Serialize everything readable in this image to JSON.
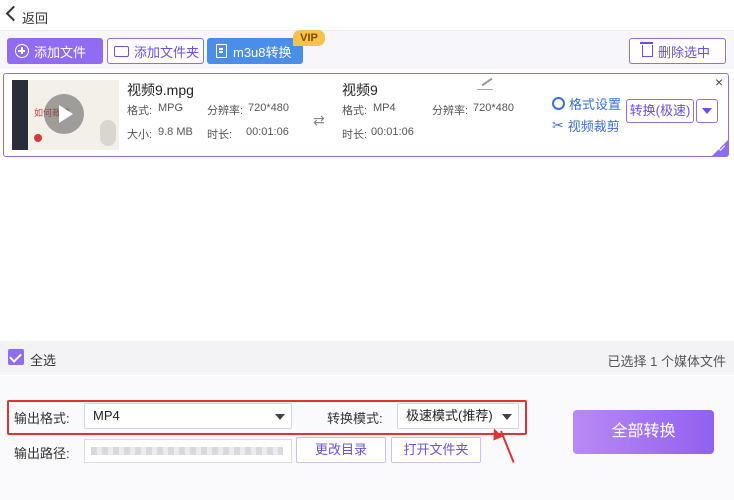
{
  "nav": {
    "back_label": "返回"
  },
  "toolbar": {
    "add_file": "添加文件",
    "add_folder": "添加文件夹",
    "m3u8": "m3u8转换",
    "vip": "VIP",
    "delete_selected": "删除选中"
  },
  "file_item": {
    "thumbnail_text": "如何裁剪",
    "source": {
      "name": "视频9.mpg",
      "format_label": "格式:",
      "format": "MPG",
      "resolution_label": "分辨率:",
      "resolution": "720*480",
      "size_label": "大小:",
      "size": "9.8 MB",
      "duration_label": "时长:",
      "duration": "00:01:06"
    },
    "target": {
      "name": "视频9",
      "format_label": "格式:",
      "format": "MP4",
      "resolution_label": "分辨率:",
      "resolution": "720*480",
      "duration_label": "时长:",
      "duration": "00:01:06"
    },
    "format_settings": "格式设置",
    "video_crop": "视频裁剪",
    "convert_button": "转换(极速)",
    "close": "×"
  },
  "selection": {
    "select_all": "全选",
    "count_text": "已选择 1 个媒体文件"
  },
  "output": {
    "format_label": "输出格式:",
    "format_value": "MP4",
    "mode_label": "转换模式:",
    "mode_value": "极速模式(推荐)",
    "path_label": "输出路径:",
    "change_dir": "更改目录",
    "open_folder": "打开文件夹",
    "convert_all": "全部转换"
  },
  "colors": {
    "accent": "#8f6cf2",
    "m3u8_button": "#4a8ee9",
    "vip_badge": "#f7c34d",
    "link_blue": "#3a6fd8",
    "annotation_red": "#e03434"
  }
}
